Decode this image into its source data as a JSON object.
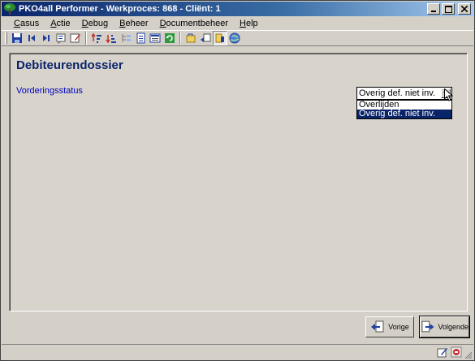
{
  "window": {
    "title": "PKO4all Performer - Werkproces: 868 - Cliënt: 1",
    "controls": [
      "minimize-icon",
      "maximize-icon",
      "close-icon"
    ]
  },
  "menubar": {
    "items": [
      {
        "hotkey": "C",
        "rest": "asus"
      },
      {
        "hotkey": "A",
        "rest": "ctie"
      },
      {
        "hotkey": "D",
        "rest": "ebug"
      },
      {
        "hotkey": "B",
        "rest": "eheer"
      },
      {
        "hotkey": "D",
        "rest": "ocumentbeheer"
      },
      {
        "hotkey": "H",
        "rest": "elp"
      }
    ]
  },
  "toolbar": {
    "icons": [
      "save-icon",
      "first-record-icon",
      "last-record-icon",
      "note-icon",
      "edit-icon",
      "sort-asc-icon",
      "sort-desc-icon",
      "tree-icon",
      "document-icon",
      "list-icon",
      "refresh-icon",
      "attach-icon",
      "back-icon",
      "selected-tool-icon",
      "globe-icon"
    ]
  },
  "panel": {
    "title": "Debiteurendossier",
    "field_label": "Vorderingsstatus",
    "select_value": "Overig def. niet inv.",
    "options": [
      "Overlijden",
      "Overig def. niet inv."
    ],
    "selected_index": 1
  },
  "navigation": {
    "prev_label": "Vorige",
    "next_label": "Volgende"
  },
  "colors": {
    "title_blue": "#0a246a",
    "label_blue": "#0000c0",
    "face": "#d4d0c8"
  }
}
